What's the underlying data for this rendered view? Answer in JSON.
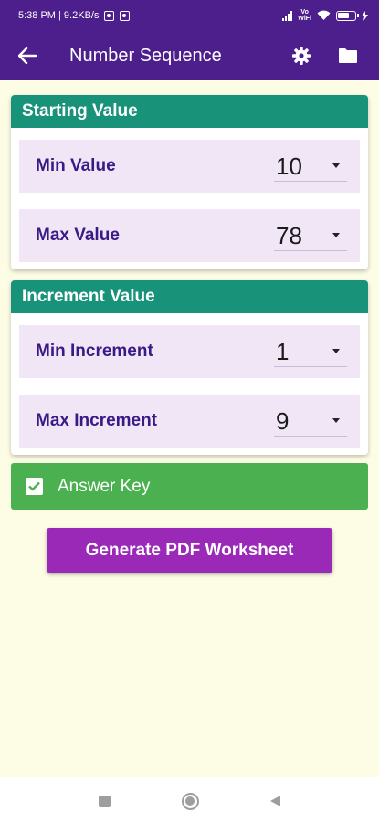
{
  "status_bar": {
    "time_speed": "5:38 PM | 9.2KB/s",
    "vowifi_line1": "Vo",
    "vowifi_line2": "WiFi",
    "battery_level_percent": 58
  },
  "app_bar": {
    "title": "Number Sequence",
    "back_icon": "arrow-left-icon",
    "settings_icon": "gear-icon",
    "folder_icon": "folder-icon"
  },
  "starting_value": {
    "header": "Starting Value",
    "min_label": "Min Value",
    "min_value": "10",
    "max_label": "Max Value",
    "max_value": "78"
  },
  "increment_value": {
    "header": "Increment Value",
    "min_label": "Min Increment",
    "min_value": "1",
    "max_label": "Max Increment",
    "max_value": "9"
  },
  "answer_key": {
    "label": "Answer Key",
    "checked": true
  },
  "generate_button": {
    "label": "Generate PDF Worksheet"
  },
  "colors": {
    "app_bar": "#4d1f8c",
    "card_header": "#19927a",
    "row_bg": "#f1e6f6",
    "label_text": "#3a1a86",
    "answer_key_bg": "#4bb04f",
    "button_bg": "#9a29b8",
    "page_bg": "#fdfde6"
  }
}
